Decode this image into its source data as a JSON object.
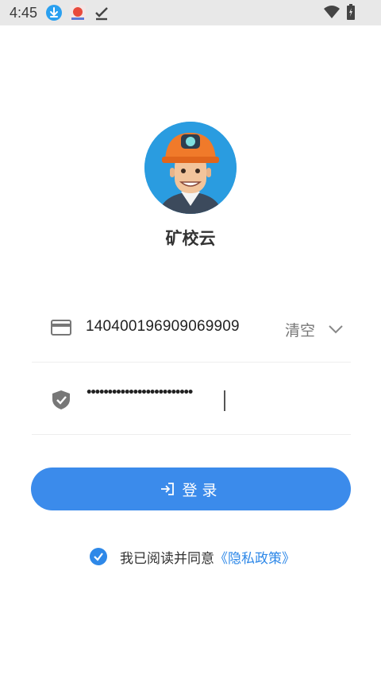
{
  "status": {
    "time": "4:45",
    "icons": [
      "download-icon",
      "app-notification-icon",
      "check-icon",
      "wifi-icon",
      "battery-icon"
    ]
  },
  "app": {
    "name": "矿校云",
    "avatar": "miner-avatar"
  },
  "form": {
    "account_value": "140400196909069909",
    "clear_label": "清空",
    "password_value": "•••••••••••••••••••••••••"
  },
  "login": {
    "label": "登录"
  },
  "agreement": {
    "text": "我已阅读并同意",
    "policy_link": "《隐私政策》",
    "checked": true
  },
  "colors": {
    "accent": "#3b8beb",
    "link": "#2e88e8",
    "statusbar": "#e8e8e8"
  }
}
